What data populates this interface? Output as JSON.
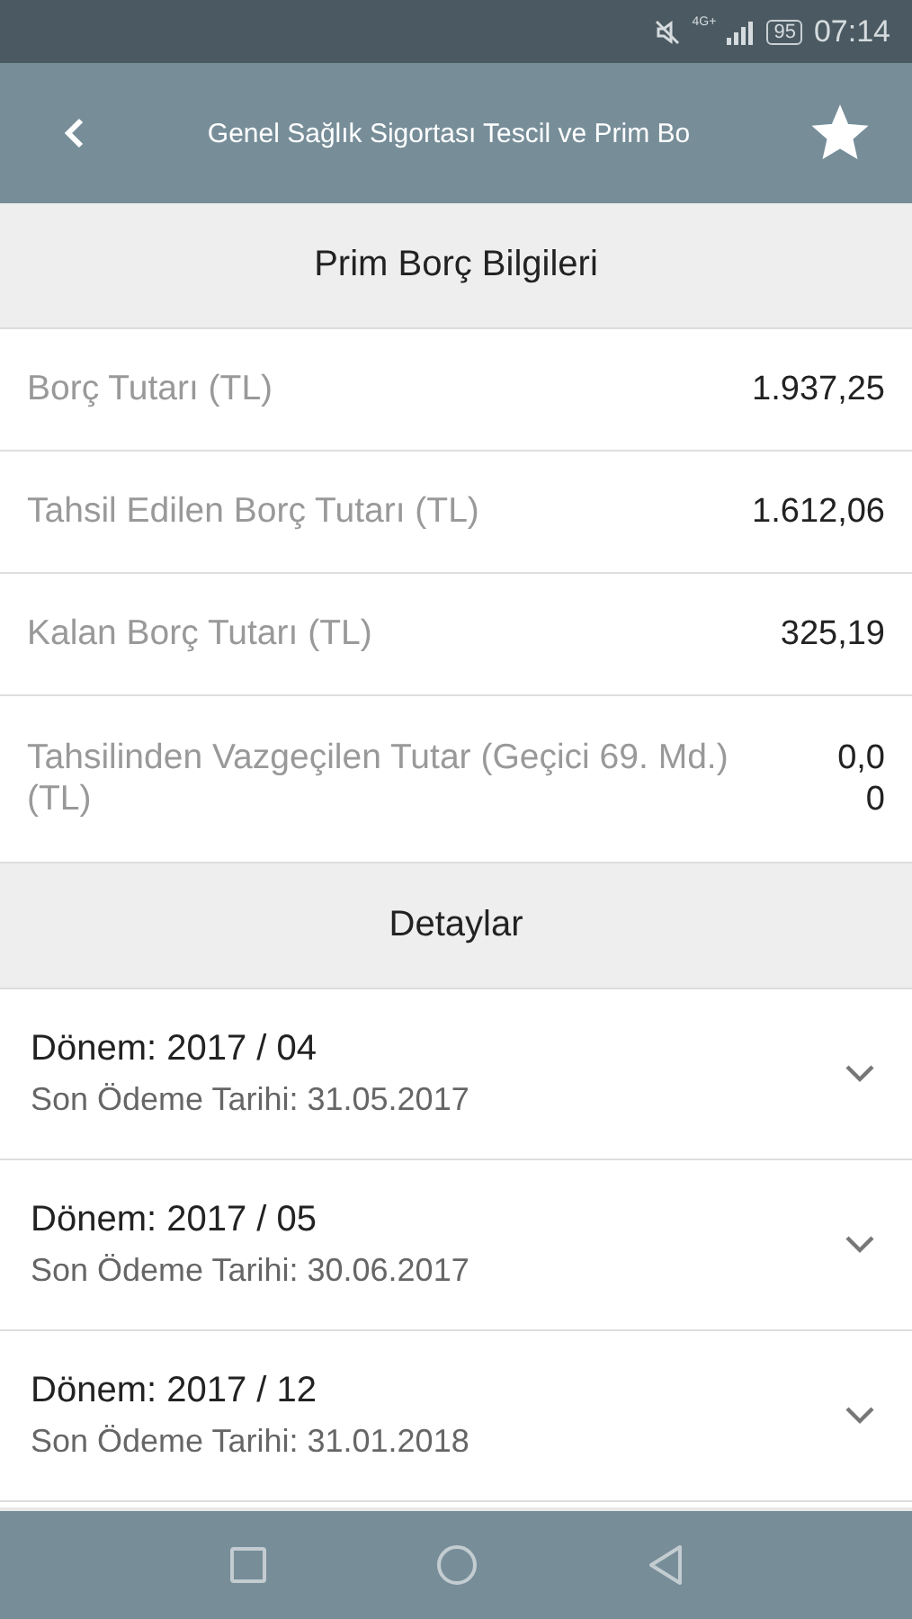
{
  "status_bar": {
    "network": "4G+",
    "battery": "95",
    "time": "07:14"
  },
  "app_bar": {
    "title": "Genel Sağlık Sigortası Tescil ve Prim Bo",
    "favorite": true
  },
  "summary": {
    "heading": "Prim Borç Bilgileri",
    "rows": [
      {
        "label": "Borç Tutarı (TL)",
        "value": "1.937,25"
      },
      {
        "label": "Tahsil Edilen Borç Tutarı (TL)",
        "value": "1.612,06"
      },
      {
        "label": "Kalan Borç Tutarı (TL)",
        "value": "325,19"
      },
      {
        "label": "Tahsilinden Vazgeçilen Tutar (Geçici 69. Md.) (TL)",
        "value": "0,00"
      }
    ]
  },
  "details": {
    "heading": "Detaylar",
    "items": [
      {
        "period": "Dönem: 2017 / 04",
        "due": "Son Ödeme Tarihi: 31.05.2017",
        "expanded": false
      },
      {
        "period": "Dönem: 2017 / 05",
        "due": "Son Ödeme Tarihi: 30.06.2017",
        "expanded": false
      },
      {
        "period": "Dönem: 2017 / 12",
        "due": "Son Ödeme Tarihi: 31.01.2018",
        "expanded": false
      }
    ]
  }
}
